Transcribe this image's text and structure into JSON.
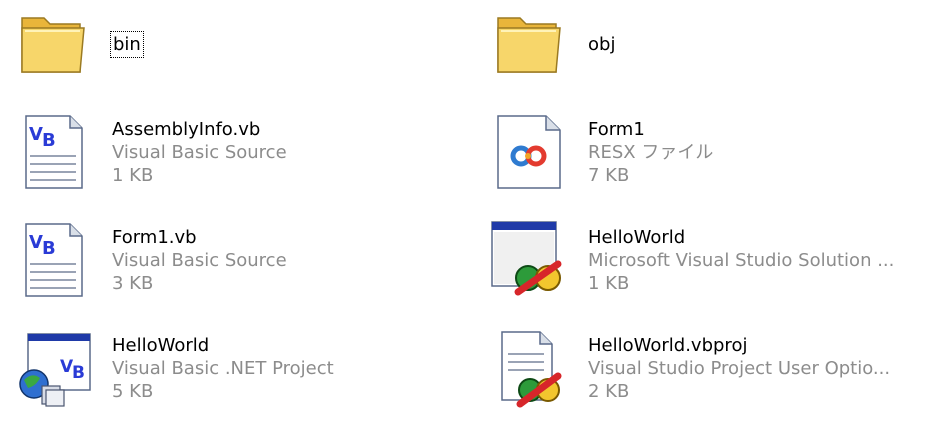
{
  "items": [
    {
      "name": "bin",
      "type": "",
      "size": "",
      "icon": "folder-icon",
      "selected": true
    },
    {
      "name": "obj",
      "type": "",
      "size": "",
      "icon": "folder-icon",
      "selected": false
    },
    {
      "name": "AssemblyInfo.vb",
      "type": "Visual Basic Source",
      "size": "1 KB",
      "icon": "vb-source-file-icon"
    },
    {
      "name": "Form1",
      "type": "RESX ファイル",
      "size": "7 KB",
      "icon": "resx-file-icon"
    },
    {
      "name": "Form1.vb",
      "type": "Visual Basic Source",
      "size": "3 KB",
      "icon": "vb-source-file-icon"
    },
    {
      "name": "HelloWorld",
      "type": "Microsoft Visual Studio Solution ...",
      "size": "1 KB",
      "icon": "vs-solution-icon"
    },
    {
      "name": "HelloWorld",
      "type": "Visual Basic .NET Project",
      "size": "5 KB",
      "icon": "vb-project-icon"
    },
    {
      "name": "HelloWorld.vbproj",
      "type": "Visual Studio Project User Optio...",
      "size": "2 KB",
      "icon": "vs-user-options-icon"
    }
  ],
  "colors": {
    "text": "#000000",
    "subtext": "#8c8c8c",
    "folder": "#f5cd55",
    "vb_blue": "#2a3bd6"
  }
}
